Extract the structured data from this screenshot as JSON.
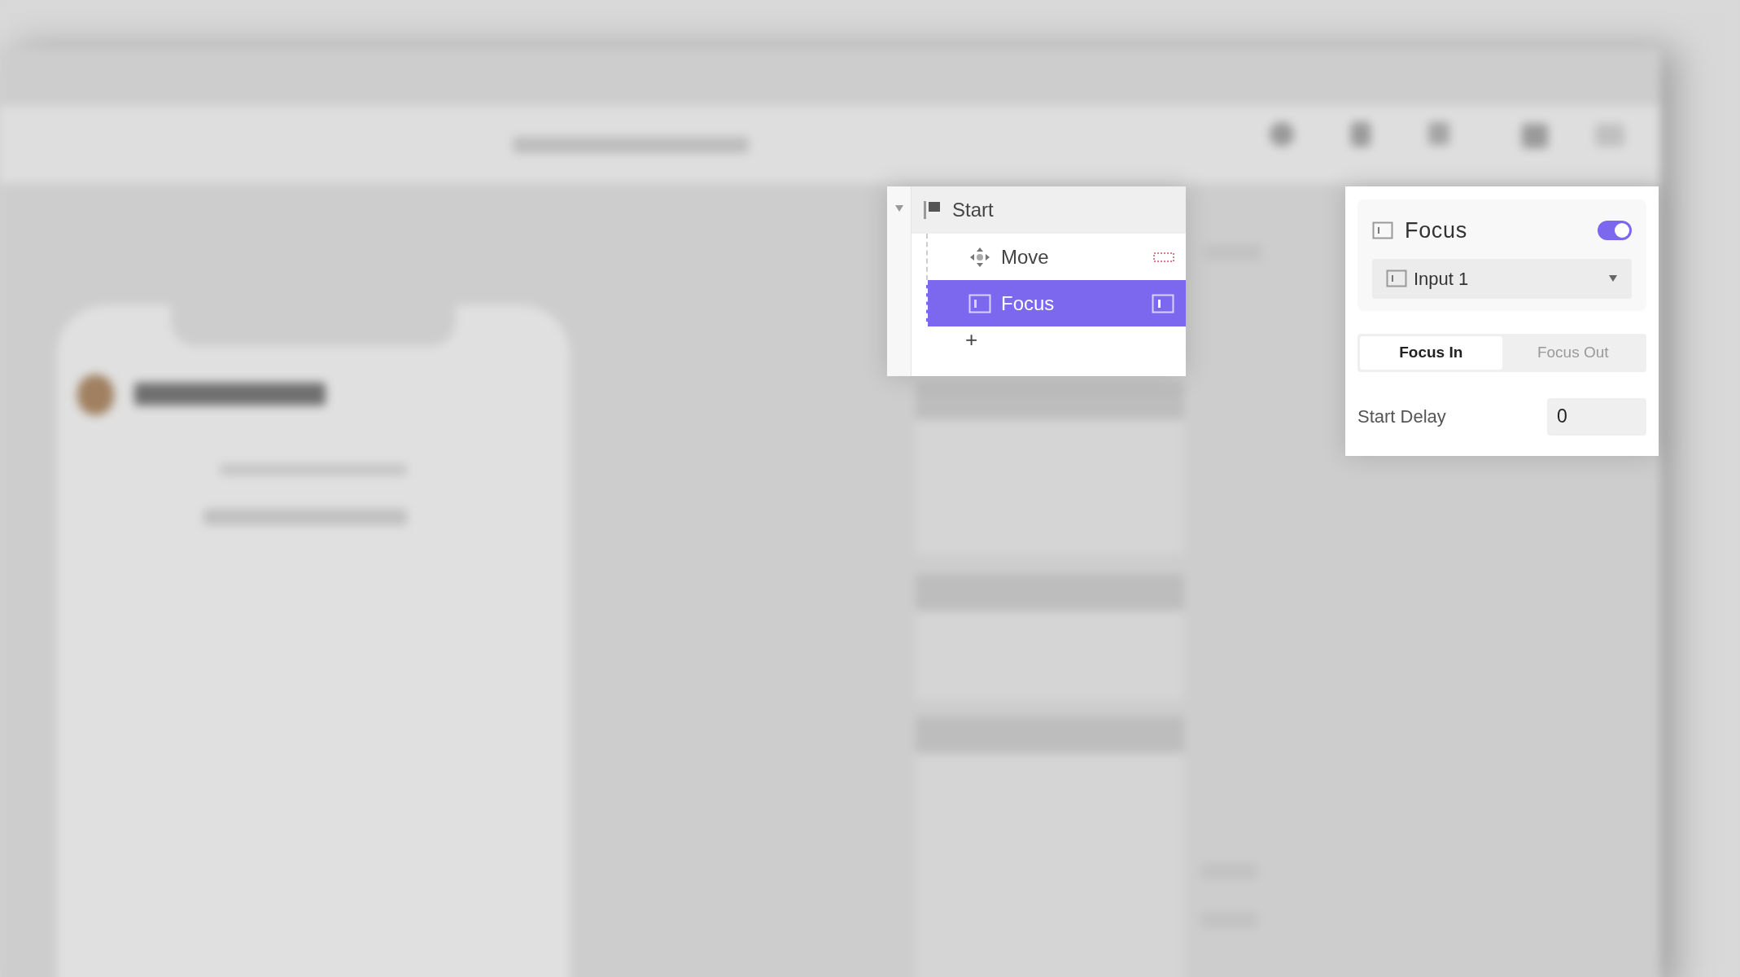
{
  "action_tree": {
    "root": {
      "label": "Start",
      "expanded": true
    },
    "items": [
      {
        "kind": "move",
        "label": "Move",
        "selected": false
      },
      {
        "kind": "input",
        "label": "Focus",
        "selected": true
      }
    ],
    "add": "+"
  },
  "inspector": {
    "title": "Focus",
    "enabled": true,
    "target": "Input 1",
    "tabs": [
      {
        "label": "Focus In",
        "selected": true
      },
      {
        "label": "Focus Out",
        "selected": false
      }
    ],
    "field": {
      "label": "Start Delay",
      "value": "0"
    }
  }
}
